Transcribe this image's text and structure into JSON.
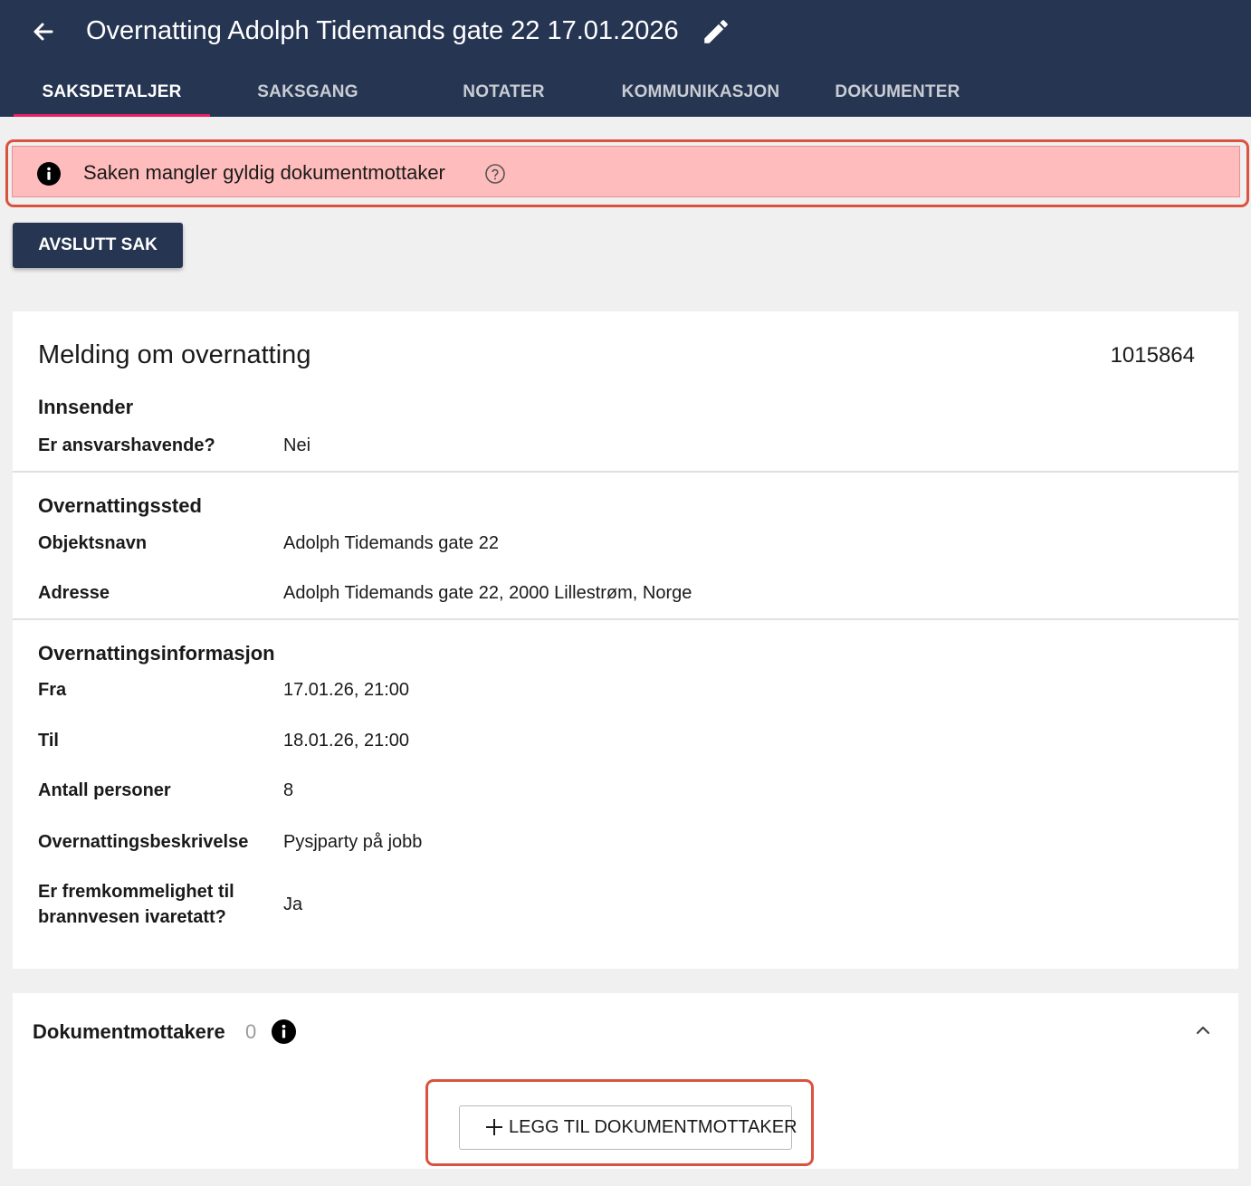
{
  "header": {
    "title": "Overnatting Adolph Tidemands gate 22 17.01.2026",
    "back_icon": "arrow-left-icon",
    "edit_icon": "pencil-icon"
  },
  "tabs": [
    {
      "label": "SAKSDETALJER",
      "active": true
    },
    {
      "label": "SAKSGANG",
      "active": false
    },
    {
      "label": "NOTATER",
      "active": false
    },
    {
      "label": "KOMMUNIKASJON",
      "active": false
    },
    {
      "label": "DOKUMENTER",
      "active": false
    }
  ],
  "alert": {
    "text": "Saken mangler gyldig dokumentmottaker",
    "icon": "info-icon",
    "help_icon": "help-circle-icon"
  },
  "actions": {
    "avslutt_label": "AVSLUTT SAK"
  },
  "card": {
    "title": "Melding om overnatting",
    "case_number": "1015864",
    "sections": [
      {
        "title": "Innsender",
        "fields": [
          {
            "label": "Er ansvarshavende?",
            "value": "Nei"
          }
        ]
      },
      {
        "title": "Overnattingssted",
        "fields": [
          {
            "label": "Objektsnavn",
            "value": "Adolph Tidemands gate 22"
          },
          {
            "label": "Adresse",
            "value": "Adolph Tidemands gate 22, 2000 Lillestrøm, Norge"
          }
        ]
      },
      {
        "title": "Overnattingsinformasjon",
        "fields": [
          {
            "label": "Fra",
            "value": "17.01.26, 21:00"
          },
          {
            "label": "Til",
            "value": "18.01.26, 21:00"
          },
          {
            "label": "Antall personer",
            "value": "8"
          },
          {
            "label": "Overnattingsbeskrivelse",
            "value": "Pysjparty på jobb"
          },
          {
            "label": "Er fremkommelighet til brannvesen ivaretatt?",
            "value": "Ja"
          }
        ]
      }
    ]
  },
  "dokumentmottakere": {
    "title": "Dokumentmottakere",
    "count": "0",
    "info_icon": "info-icon",
    "collapse_icon": "chevron-up-icon",
    "add_label": "LEGG TIL DOKUMENTMOTTAKER",
    "add_icon": "plus-icon"
  },
  "colors": {
    "header_bg": "#263552",
    "tab_indicator": "#e91e63",
    "alert_bg": "#ffbcbc",
    "highlight_outline": "#d9533f",
    "page_bg": "#f0f0f0"
  }
}
